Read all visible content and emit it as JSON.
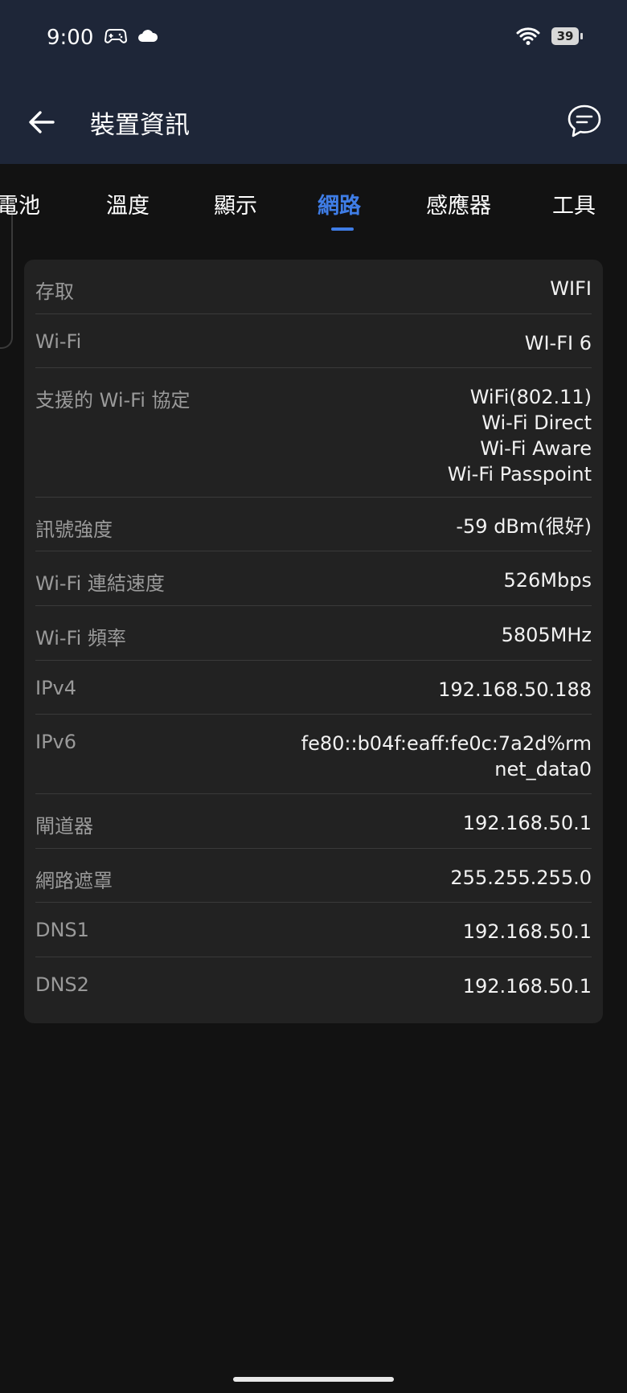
{
  "status_bar": {
    "time": "9:00",
    "battery_level": "39"
  },
  "header": {
    "title": "裝置資訊"
  },
  "tabs": [
    {
      "label": "電池",
      "active": false
    },
    {
      "label": "溫度",
      "active": false
    },
    {
      "label": "顯示",
      "active": false
    },
    {
      "label": "網路",
      "active": true
    },
    {
      "label": "感應器",
      "active": false
    },
    {
      "label": "工具",
      "active": false
    }
  ],
  "network": [
    {
      "label": "存取",
      "values": [
        "WIFI"
      ]
    },
    {
      "label": "Wi-Fi",
      "values": [
        "WI-FI 6"
      ]
    },
    {
      "label": "支援的 Wi-Fi 協定",
      "values": [
        "WiFi(802.11)",
        "Wi-Fi Direct",
        "Wi-Fi Aware",
        "Wi-Fi Passpoint"
      ]
    },
    {
      "label": "訊號強度",
      "values": [
        "-59 dBm(很好)"
      ]
    },
    {
      "label": "Wi-Fi 連結速度",
      "values": [
        "526Mbps"
      ]
    },
    {
      "label": "Wi-Fi 頻率",
      "values": [
        "5805MHz"
      ]
    },
    {
      "label": "IPv4",
      "values": [
        "192.168.50.188"
      ]
    },
    {
      "label": "IPv6",
      "values": [
        "fe80::b04f:eaff:fe0c:7a2d%rm",
        "net_data0"
      ]
    },
    {
      "label": "閘道器",
      "values": [
        "192.168.50.1"
      ]
    },
    {
      "label": "網路遮罩",
      "values": [
        "255.255.255.0"
      ]
    },
    {
      "label": "DNS1",
      "values": [
        "192.168.50.1"
      ]
    },
    {
      "label": "DNS2",
      "values": [
        "192.168.50.1"
      ]
    }
  ],
  "colors": {
    "accent": "#3f7de6",
    "header_bg": "#1e2638",
    "card_bg": "#222222",
    "page_bg": "#121212"
  }
}
